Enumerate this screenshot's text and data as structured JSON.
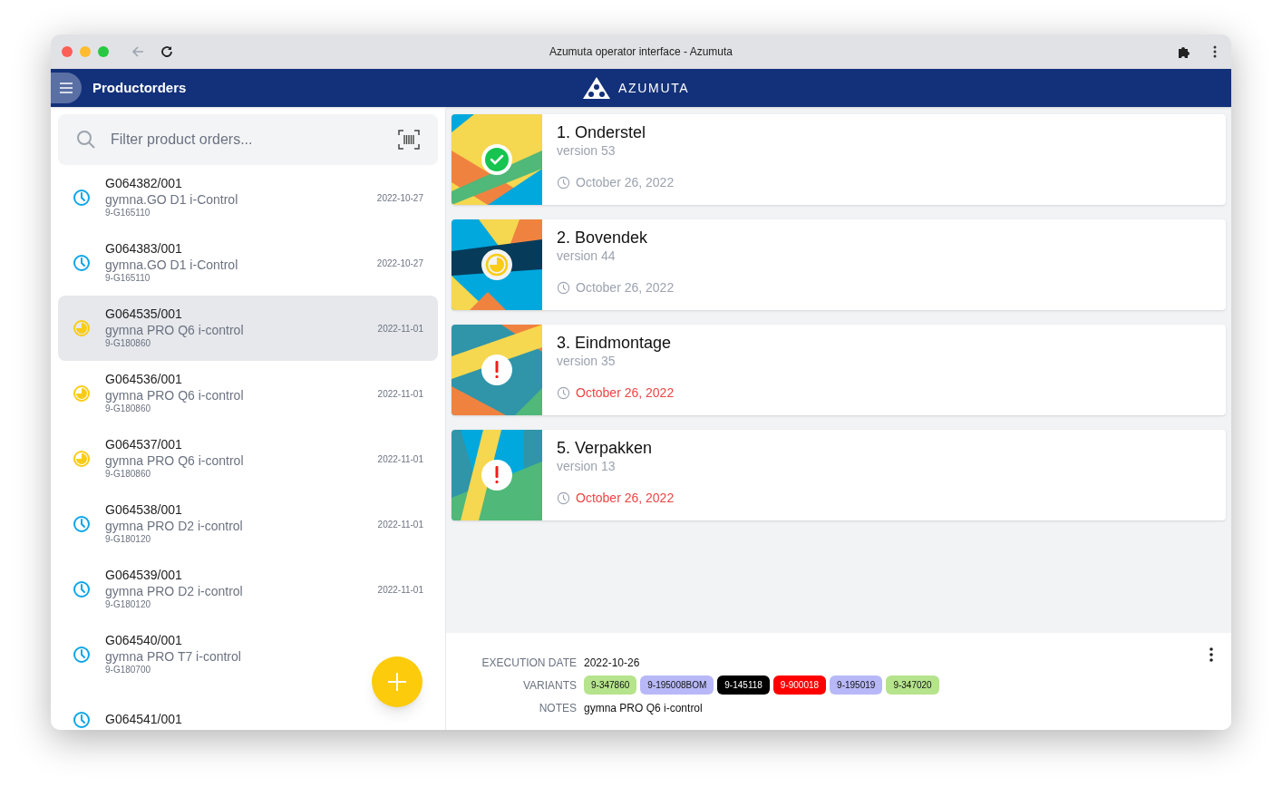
{
  "window": {
    "title": "Azumuta operator interface - Azumuta"
  },
  "app_bar": {
    "title": "Productorders",
    "logo_text": "AZUMUTA"
  },
  "search": {
    "placeholder": "Filter product orders..."
  },
  "orders": [
    {
      "code": "G064382/001",
      "product": "gymna.GO D1 i-Control",
      "article": "9-G165110",
      "date": "2022-10-27",
      "kind": "scheduled",
      "selected": false
    },
    {
      "code": "G064383/001",
      "product": "gymna.GO D1 i-Control",
      "article": "9-G165110",
      "date": "2022-10-27",
      "kind": "scheduled",
      "selected": false
    },
    {
      "code": "G064535/001",
      "product": "gymna PRO Q6 i-control",
      "article": "9-G180860",
      "date": "2022-11-01",
      "kind": "in_progress",
      "selected": true
    },
    {
      "code": "G064536/001",
      "product": "gymna PRO Q6 i-control",
      "article": "9-G180860",
      "date": "2022-11-01",
      "kind": "in_progress",
      "selected": false
    },
    {
      "code": "G064537/001",
      "product": "gymna PRO Q6 i-control",
      "article": "9-G180860",
      "date": "2022-11-01",
      "kind": "in_progress",
      "selected": false
    },
    {
      "code": "G064538/001",
      "product": "gymna PRO D2 i-control",
      "article": "9-G180120",
      "date": "2022-11-01",
      "kind": "scheduled",
      "selected": false
    },
    {
      "code": "G064539/001",
      "product": "gymna PRO D2 i-control",
      "article": "9-G180120",
      "date": "2022-11-01",
      "kind": "scheduled",
      "selected": false
    },
    {
      "code": "G064540/001",
      "product": "gymna PRO T7 i-control",
      "article": "9-G180700",
      "kind": "scheduled",
      "selected": false
    },
    {
      "code": "G064541/001",
      "kind": "scheduled",
      "selected": false
    }
  ],
  "operations": [
    {
      "title": "1. Onderstel",
      "version": "version 53",
      "date": "October 26, 2022",
      "kind": "done",
      "overdue": false
    },
    {
      "title": "2. Bovendek",
      "version": "version 44",
      "date": "October 26, 2022",
      "kind": "in_progress",
      "overdue": false
    },
    {
      "title": "3. Eindmontage",
      "version": "version 35",
      "date": "October 26, 2022",
      "kind": "warning",
      "overdue": true
    },
    {
      "title": "5. Verpakken",
      "version": "version 13",
      "date": "October 26, 2022",
      "kind": "warning",
      "overdue": true
    }
  ],
  "details": {
    "fields": [
      {
        "label": "EXECUTION DATE",
        "value": "2022-10-26"
      },
      {
        "label": "VARIANTS",
        "tags": [
          {
            "text": "9-347860",
            "color": "#b5e48c"
          },
          {
            "text": "9-195008BOM",
            "color": "#b8b8f8"
          },
          {
            "text": "9-145118",
            "color": "#000000"
          },
          {
            "text": "9-900018",
            "color": "#ff0000"
          },
          {
            "text": "9-195019",
            "color": "#b8b8f8"
          },
          {
            "text": "9-347020",
            "color": "#b5e48c"
          }
        ]
      },
      {
        "label": "NOTES",
        "value": "gymna PRO Q6 i-control"
      }
    ]
  }
}
